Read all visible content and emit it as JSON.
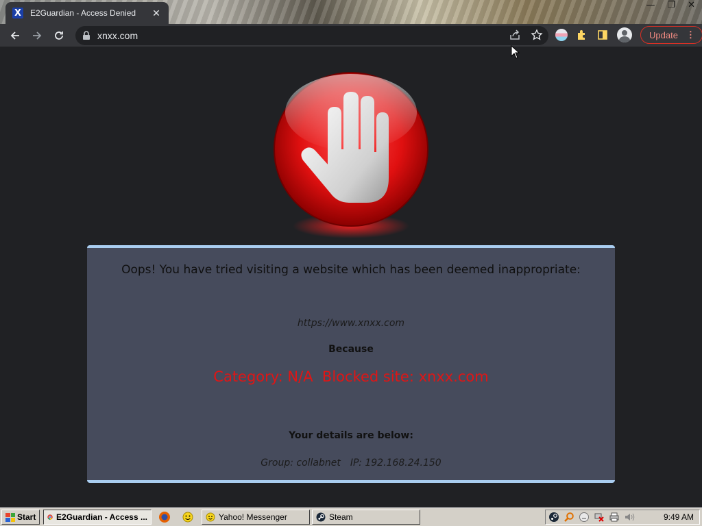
{
  "browser": {
    "tab_title": "E2Guardian - Access Denied",
    "tab_favicon_letter": "X",
    "tab_close": "✕",
    "url": "xnxx.com",
    "update_label": "Update",
    "update_menu": "⋮"
  },
  "window_controls": {
    "minimize": "—",
    "restore": "❐",
    "close": "✕"
  },
  "block_page": {
    "title": "Oops! You have tried visiting a website which has been deemed inappropriate:",
    "blocked_url": "https://www.xnxx.com",
    "because_label": "Because",
    "reason": "Category: N/A  Blocked site: xnxx.com",
    "details_label": "Your details are below:",
    "group": "Group: collabnet",
    "ip": "IP: 192.168.24.150"
  },
  "taskbar": {
    "start_label": "Start",
    "tasks": [
      {
        "label": "E2Guardian - Access ...",
        "icon": "chrome-icon",
        "active": true
      },
      {
        "label": "Yahoo! Messenger",
        "icon": "yahoo-messenger-icon",
        "active": false
      },
      {
        "label": "Steam",
        "icon": "steam-icon",
        "active": false
      }
    ],
    "quick_launch": [
      "firefox-icon",
      "messenger-smiley-icon"
    ],
    "tray_icons": [
      "steam-tray-icon",
      "search-tray-icon",
      "smiley-tray-icon",
      "network-x-icon",
      "printer-icon",
      "volume-icon"
    ],
    "clock": "9:49 AM"
  },
  "colors": {
    "page_bg": "#202124",
    "panel_bg": "#464b5c",
    "panel_border": "#a9cdf0",
    "reason_text": "#e01515",
    "update_accent": "#d93025"
  }
}
